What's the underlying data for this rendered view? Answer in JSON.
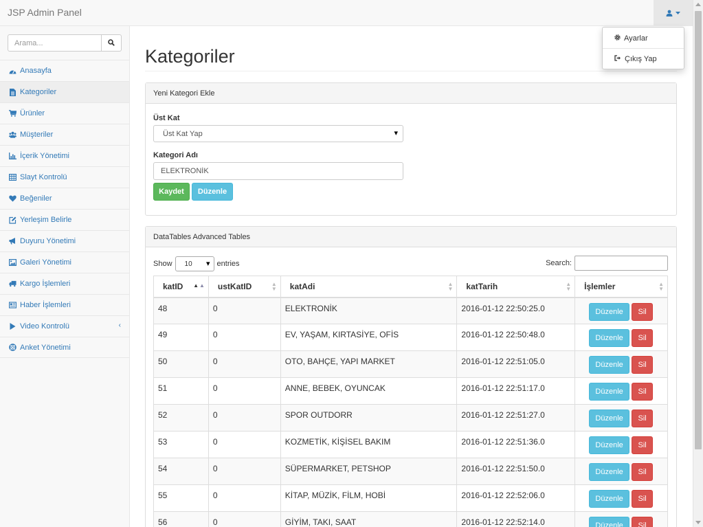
{
  "navbar": {
    "brand": "JSP Admin Panel"
  },
  "user_menu": {
    "items": [
      {
        "label": "Ayarlar",
        "icon": "gear-icon"
      },
      {
        "label": "Çıkış Yap",
        "icon": "sign-out-icon"
      }
    ]
  },
  "sidebar": {
    "search_placeholder": "Arama...",
    "items": [
      {
        "label": "Anasayfa",
        "icon": "dashboard-icon"
      },
      {
        "label": "Kategoriler",
        "icon": "file-icon"
      },
      {
        "label": "Ürünler",
        "icon": "cart-icon"
      },
      {
        "label": "Müşteriler",
        "icon": "users-icon"
      },
      {
        "label": "İçerik Yönetimi",
        "icon": "bar-chart-icon"
      },
      {
        "label": "Slayt Kontrolü",
        "icon": "table-icon"
      },
      {
        "label": "Beğeniler",
        "icon": "heart-icon"
      },
      {
        "label": "Yerleşim Belirle",
        "icon": "edit-icon"
      },
      {
        "label": "Duyuru Yönetimi",
        "icon": "bullhorn-icon"
      },
      {
        "label": "Galeri Yönetimi",
        "icon": "picture-icon"
      },
      {
        "label": "Kargo İşlemleri",
        "icon": "truck-icon"
      },
      {
        "label": "Haber İşlemleri",
        "icon": "newspaper-icon"
      },
      {
        "label": "Video Kontrolü",
        "icon": "play-icon"
      },
      {
        "label": "Anket Yönetimi",
        "icon": "support-icon"
      }
    ]
  },
  "page": {
    "title": "Kategoriler"
  },
  "form_panel": {
    "heading": "Yeni Kategori Ekle",
    "parent_label": "Üst Kat",
    "parent_selected": "Üst Kat Yap",
    "name_label": "Kategori Adı",
    "name_value": "ELEKTRONİK",
    "save_label": "Kaydet",
    "edit_label": "Düzenle"
  },
  "table_panel": {
    "heading": "DataTables Advanced Tables",
    "show_label": "Show",
    "page_length": "10",
    "entries_label": "entries",
    "search_label": "Search:",
    "columns": [
      "katID",
      "ustKatID",
      "katAdi",
      "katTarih",
      "İşlemler"
    ],
    "edit_label": "Düzenle",
    "delete_label": "Sil",
    "rows": [
      [
        "48",
        "0",
        "ELEKTRONİK",
        "2016-01-12 22:50:25.0"
      ],
      [
        "49",
        "0",
        "EV, YAŞAM, KIRTASİYE, OFİS",
        "2016-01-12 22:50:48.0"
      ],
      [
        "50",
        "0",
        "OTO, BAHÇE, YAPI MARKET",
        "2016-01-12 22:51:05.0"
      ],
      [
        "51",
        "0",
        "ANNE, BEBEK, OYUNCAK",
        "2016-01-12 22:51:17.0"
      ],
      [
        "52",
        "0",
        "SPOR OUTDORR",
        "2016-01-12 22:51:27.0"
      ],
      [
        "53",
        "0",
        "KOZMETİK, KİŞİSEL BAKIM",
        "2016-01-12 22:51:36.0"
      ],
      [
        "54",
        "0",
        "SÜPERMARKET, PETSHOP",
        "2016-01-12 22:51:50.0"
      ],
      [
        "55",
        "0",
        "KİTAP, MÜZİK, FİLM, HOBİ",
        "2016-01-12 22:52:06.0"
      ],
      [
        "56",
        "0",
        "GİYİM, TAKI, SAAT",
        "2016-01-12 22:52:14.0"
      ]
    ]
  },
  "colors": {
    "link": "#337ab7",
    "success": "#5cb85c",
    "info": "#5bc0de",
    "danger": "#d9534f"
  }
}
